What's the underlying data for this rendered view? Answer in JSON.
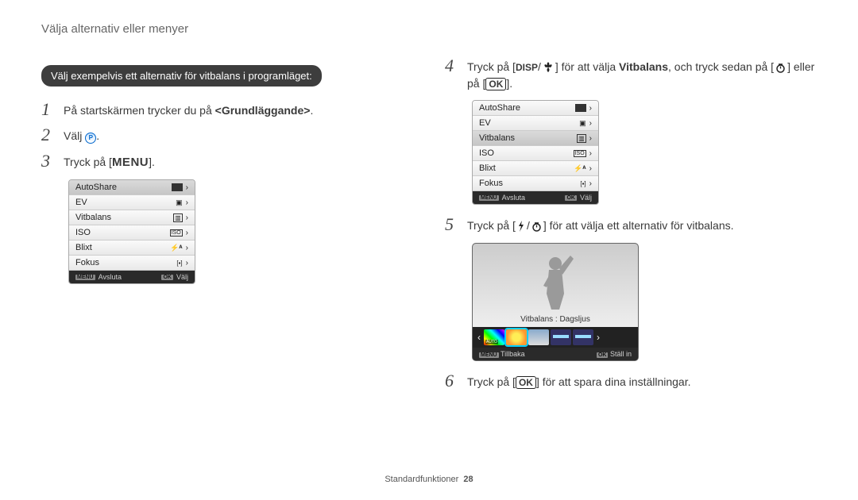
{
  "header": {
    "title": "Välja alternativ eller menyer"
  },
  "leftCol": {
    "box_label": "Välj exempelvis ett alternativ för vitbalans i programläget:",
    "step1": {
      "num": "1",
      "text_before": "På startskärmen trycker du på ",
      "bold": "<Grundläggande>",
      "text_after": "."
    },
    "step2": {
      "num": "2",
      "text": "Välj ",
      "icon_label": "P",
      "period": "."
    },
    "step3": {
      "num": "3",
      "text_before": "Tryck på [",
      "menu": "MENU",
      "text_after": "]."
    }
  },
  "rightCol": {
    "step4": {
      "num": "4",
      "t1": "Tryck på [",
      "disp": "DISP",
      "slash": "/",
      "t2": "] för att välja ",
      "bold": "Vitbalans",
      "t3": ", och tryck sedan på [",
      "t4": "] eller på [",
      "ok": "OK",
      "t5": "]."
    },
    "step5": {
      "num": "5",
      "t1": "Tryck på [",
      "slash": "/",
      "t2": "] för att välja ett alternativ för vitbalans."
    },
    "step6": {
      "num": "6",
      "t1": "Tryck på [",
      "ok": "OK",
      "t2": "] för att spara dina inställningar."
    }
  },
  "cameraMenu": {
    "items": [
      {
        "label": "AutoShare"
      },
      {
        "label": "EV"
      },
      {
        "label": "Vitbalans"
      },
      {
        "label": "ISO"
      },
      {
        "label": "Blixt"
      },
      {
        "label": "Fokus"
      }
    ],
    "footer_left_key": "MENU",
    "footer_left": "Avsluta",
    "footer_right_key": "OK",
    "footer_right": "Välj"
  },
  "wb": {
    "caption": "Vitbalans : Dagsljus",
    "footer_left_key": "MENU",
    "footer_left": "Tillbaka",
    "footer_right_key": "OK",
    "footer_right": "Ställ in",
    "arrow_left": "‹",
    "arrow_right": "›"
  },
  "footer": {
    "label": "Standardfunktioner",
    "page": "28"
  }
}
